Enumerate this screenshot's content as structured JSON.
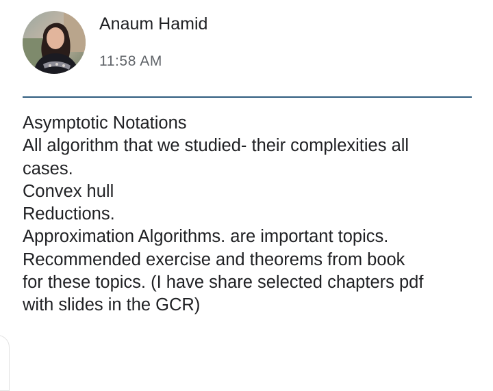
{
  "post": {
    "author": {
      "name": "Anaum Hamid",
      "avatar_icon": "user-avatar-photo"
    },
    "timestamp": "11:58 AM",
    "divider_color": "#2d5b7e",
    "body_lines": [
      "Asymptotic Notations",
      "All algorithm that we studied- their complexities all",
      "cases.",
      "Convex hull",
      "Reductions.",
      "Approximation Algorithms. are important topics.",
      "Recommended exercise and theorems from book",
      "for these topics. (I have share selected chapters pdf",
      "with slides in the GCR)"
    ]
  }
}
